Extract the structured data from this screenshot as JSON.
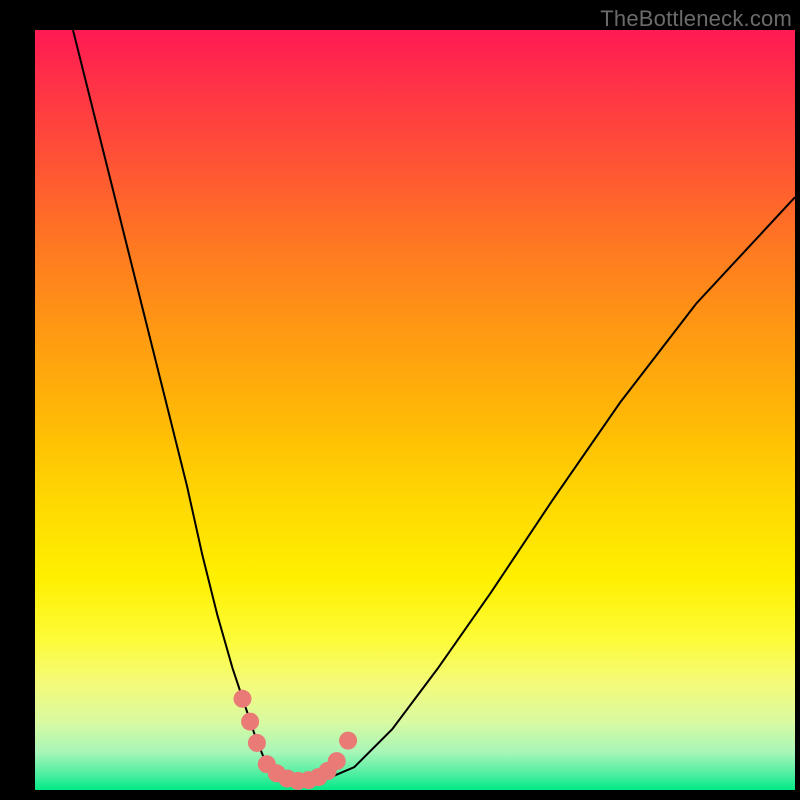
{
  "watermark": "TheBottleneck.com",
  "chart_data": {
    "type": "line",
    "title": "",
    "xlabel": "",
    "ylabel": "",
    "xlim": [
      0,
      100
    ],
    "ylim": [
      0,
      100
    ],
    "grid": false,
    "series": [
      {
        "name": "bottleneck-curve",
        "x": [
          5,
          8,
          11,
          14,
          17,
          20,
          22,
          24,
          26,
          28,
          29,
          30,
          31,
          32,
          34,
          36,
          38,
          42,
          47,
          53,
          60,
          68,
          77,
          87,
          100
        ],
        "y": [
          100,
          88,
          76,
          64,
          52,
          40,
          31,
          23,
          16,
          10,
          7,
          4.5,
          3,
          2,
          1.2,
          1,
          1.3,
          3,
          8,
          16,
          26,
          38,
          51,
          64,
          78
        ],
        "color": "#000000",
        "width": 2
      }
    ],
    "markers": {
      "name": "highlighted-points",
      "color": "#ea7a76",
      "radius": 9,
      "points": [
        {
          "x": 27.3,
          "y": 12.0
        },
        {
          "x": 28.3,
          "y": 9.0
        },
        {
          "x": 29.2,
          "y": 6.2
        },
        {
          "x": 30.5,
          "y": 3.4
        },
        {
          "x": 31.8,
          "y": 2.2
        },
        {
          "x": 33.2,
          "y": 1.5
        },
        {
          "x": 34.6,
          "y": 1.2
        },
        {
          "x": 36.0,
          "y": 1.3
        },
        {
          "x": 37.3,
          "y": 1.7
        },
        {
          "x": 38.5,
          "y": 2.5
        },
        {
          "x": 39.7,
          "y": 3.8
        },
        {
          "x": 41.2,
          "y": 6.5
        }
      ]
    },
    "background": {
      "type": "vertical-gradient",
      "stops": [
        {
          "offset": 0,
          "color": "#ff1a54"
        },
        {
          "offset": 18,
          "color": "#ff5534"
        },
        {
          "offset": 40,
          "color": "#ff9a12"
        },
        {
          "offset": 62,
          "color": "#ffd802"
        },
        {
          "offset": 80,
          "color": "#fdfb36"
        },
        {
          "offset": 95,
          "color": "#a8f6b8"
        },
        {
          "offset": 100,
          "color": "#00e985"
        }
      ]
    }
  }
}
